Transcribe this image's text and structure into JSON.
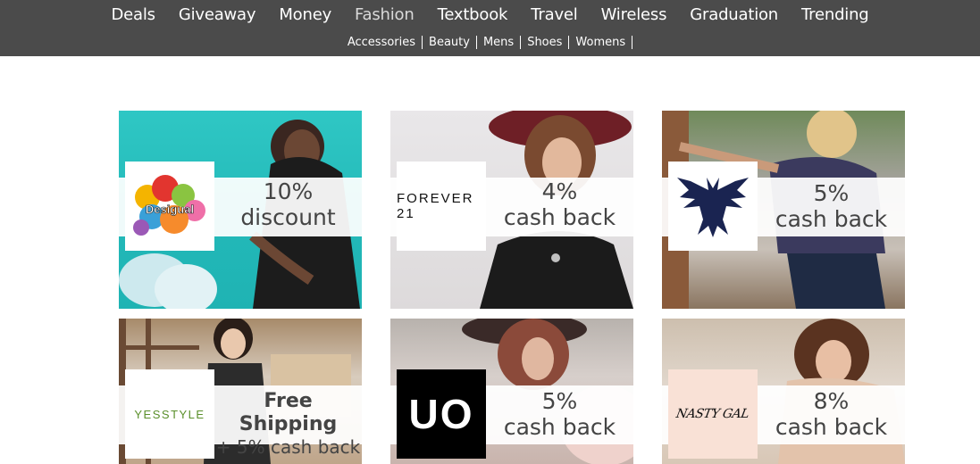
{
  "nav": {
    "main": [
      "Deals",
      "Giveaway",
      "Money",
      "Fashion",
      "Textbook",
      "Travel",
      "Wireless",
      "Graduation",
      "Trending"
    ],
    "active": "Fashion",
    "sub": [
      "Accessories",
      "Beauty",
      "Mens",
      "Shoes",
      "Womens"
    ]
  },
  "tiles": [
    {
      "brand": "Desigual",
      "line1": "10%",
      "line2": "discount"
    },
    {
      "brand": "FOREVER 21",
      "line1": "4%",
      "line2": "cash back"
    },
    {
      "brand": "American Eagle",
      "line1": "5%",
      "line2": "cash back"
    },
    {
      "brand": "YESSTYLE",
      "line1": "Free Shipping",
      "line2": "+ 5% cash back"
    },
    {
      "brand": "UO",
      "line1": "5%",
      "line2": "cash back"
    },
    {
      "brand": "NASTY GAL",
      "line1": "8%",
      "line2": "cash back"
    }
  ],
  "icons": {
    "eagle": "american-eagle-logo-icon"
  },
  "colors": {
    "topbar": "#4b4b4b",
    "offer_text": "#444444"
  }
}
